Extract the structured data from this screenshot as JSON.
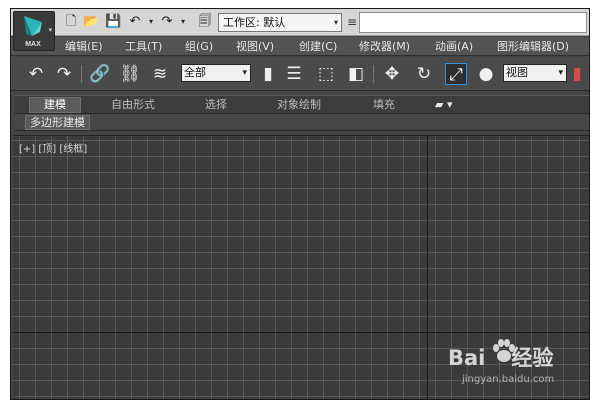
{
  "app": {
    "logo_text": "MAX"
  },
  "quickaccess": {
    "workspace_label": "工作区: 默认",
    "title_value": ""
  },
  "menu": {
    "items": [
      "编辑(E)",
      "工具(T)",
      "组(G)",
      "视图(V)",
      "创建(C)",
      "修改器(M)",
      "动画(A)",
      "图形编辑器(D)"
    ]
  },
  "toolbar": {
    "selection_filter": "全部",
    "reference_coord": "视图"
  },
  "ribbon": {
    "tabs": [
      "建模",
      "自由形式",
      "选择",
      "对象绘制",
      "填充"
    ],
    "active_tab": "建模",
    "subpanel_label": "多边形建模"
  },
  "viewport": {
    "label": "[+] [顶] [线框]"
  },
  "watermark": {
    "brand_left": "Bai",
    "brand_right": "经验",
    "url": "jingyan.baidu.com"
  },
  "colors": {
    "logo_accent": "#2bb5b5",
    "ui_dark": "#444444",
    "toolbar_highlight": "#3a8fd8"
  }
}
